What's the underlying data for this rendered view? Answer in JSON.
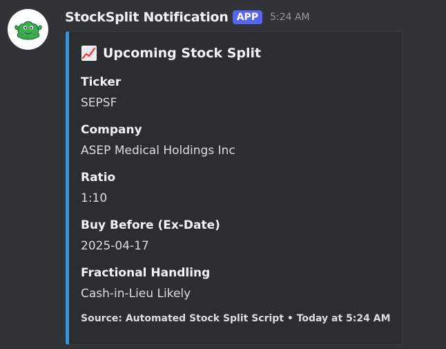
{
  "message": {
    "username": "StockSplit Notification",
    "badge": "APP",
    "timestamp": "5:24 AM",
    "avatar_icon": "green-frog-mascot-icon"
  },
  "embed": {
    "accent_color": "#3694e0",
    "title_icon": "chart-increasing-icon",
    "title": "Upcoming Stock Split",
    "fields": [
      {
        "name": "Ticker",
        "value": "SEPSF"
      },
      {
        "name": "Company",
        "value": "ASEP Medical Holdings Inc"
      },
      {
        "name": "Ratio",
        "value": "1:10"
      },
      {
        "name": "Buy Before (Ex-Date)",
        "value": "2025-04-17"
      },
      {
        "name": "Fractional Handling",
        "value": "Cash-in-Lieu Likely"
      }
    ],
    "footer": "Source: Automated Stock Split Script • Today at 5:24 AM"
  }
}
